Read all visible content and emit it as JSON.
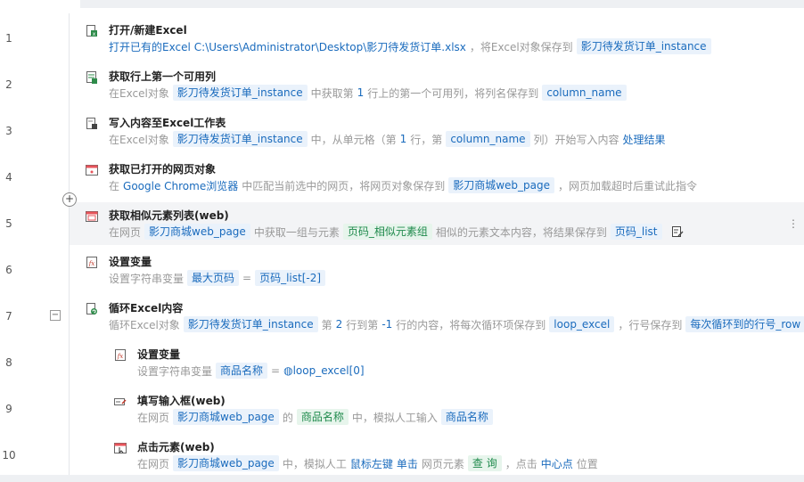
{
  "line_numbers": [
    "1",
    "2",
    "3",
    "4",
    "5",
    "6",
    "7",
    "8",
    "9",
    "10"
  ],
  "steps": [
    {
      "title": "打开/新建Excel",
      "icon": "excel-file-icon",
      "parts": [
        {
          "t": "blue",
          "v": "打开已有的Excel"
        },
        {
          "t": "blue",
          "v": "C:\\Users\\Administrator\\Desktop\\影刀待发货订单.xlsx"
        },
        {
          "t": "text",
          "v": "，将Excel对象保存到"
        },
        {
          "t": "tok",
          "v": "影刀待发货订单_instance"
        }
      ]
    },
    {
      "title": "获取行上第一个可用列",
      "icon": "excel-column-icon",
      "parts": [
        {
          "t": "text",
          "v": "在Excel对象"
        },
        {
          "t": "tok",
          "v": "影刀待发货订单_instance"
        },
        {
          "t": "text",
          "v": "中获取第"
        },
        {
          "t": "kw",
          "v": "1"
        },
        {
          "t": "text",
          "v": "行上的第一个可用列，将列名保存到"
        },
        {
          "t": "tok",
          "v": "column_name"
        }
      ]
    },
    {
      "title": "写入内容至Excel工作表",
      "icon": "excel-write-icon",
      "parts": [
        {
          "t": "text",
          "v": "在Excel对象"
        },
        {
          "t": "tok",
          "v": "影刀待发货订单_instance"
        },
        {
          "t": "text",
          "v": "中，从单元格（第"
        },
        {
          "t": "kw",
          "v": "1"
        },
        {
          "t": "text",
          "v": "行，第"
        },
        {
          "t": "tok",
          "v": "column_name"
        },
        {
          "t": "text",
          "v": "列）开始写入内容"
        },
        {
          "t": "kw",
          "v": "处理结果"
        }
      ]
    },
    {
      "title": "获取已打开的网页对象",
      "icon": "browser-page-icon",
      "parts": [
        {
          "t": "text",
          "v": "在"
        },
        {
          "t": "kw",
          "v": "Google Chrome浏览器"
        },
        {
          "t": "text",
          "v": "中匹配当前选中的网页，将网页对象保存到"
        },
        {
          "t": "tok",
          "v": "影刀商城web_page"
        },
        {
          "t": "text",
          "v": "，网页加载超时后重试此指令"
        }
      ]
    },
    {
      "title": "获取相似元素列表(web)",
      "icon": "similar-elements-icon",
      "parts": [
        {
          "t": "text",
          "v": "在网页"
        },
        {
          "t": "tok",
          "v": "影刀商城web_page"
        },
        {
          "t": "text",
          "v": "中获取一组与元素"
        },
        {
          "t": "tokg",
          "v": "页码_相似元素组"
        },
        {
          "t": "text",
          "v": "相似的元素文本内容，将结果保存到"
        },
        {
          "t": "tok",
          "v": "页码_list"
        }
      ]
    },
    {
      "title": "设置变量",
      "icon": "variable-fx-icon",
      "parts": [
        {
          "t": "text",
          "v": "设置字符串变量"
        },
        {
          "t": "tok",
          "v": "最大页码"
        },
        {
          "t": "text",
          "v": "="
        },
        {
          "t": "tok",
          "v": "页码_list[-2]"
        }
      ]
    },
    {
      "title": "循环Excel内容",
      "icon": "excel-loop-icon",
      "parts": [
        {
          "t": "text",
          "v": "循环Excel对象"
        },
        {
          "t": "tok",
          "v": "影刀待发货订单_instance"
        },
        {
          "t": "text",
          "v": "第"
        },
        {
          "t": "kw",
          "v": "2"
        },
        {
          "t": "text",
          "v": "行到第"
        },
        {
          "t": "kw",
          "v": "-1"
        },
        {
          "t": "text",
          "v": "行的内容，将每次循环项保存到"
        },
        {
          "t": "tok",
          "v": "loop_excel"
        },
        {
          "t": "text",
          "v": "，行号保存到"
        },
        {
          "t": "tok",
          "v": "每次循环到的行号_row"
        }
      ]
    },
    {
      "title": "设置变量",
      "icon": "variable-fx-icon",
      "parts": [
        {
          "t": "text",
          "v": "设置字符串变量"
        },
        {
          "t": "tok",
          "v": "商品名称"
        },
        {
          "t": "text",
          "v": "="
        },
        {
          "t": "var",
          "v": "loop_excel[0]"
        }
      ]
    },
    {
      "title": "填写输入框(web)",
      "icon": "input-fill-icon",
      "parts": [
        {
          "t": "text",
          "v": "在网页"
        },
        {
          "t": "tok",
          "v": "影刀商城web_page"
        },
        {
          "t": "text",
          "v": "的"
        },
        {
          "t": "tokg",
          "v": "商品名称"
        },
        {
          "t": "text",
          "v": "中，模拟人工输入"
        },
        {
          "t": "tok",
          "v": "商品名称"
        }
      ]
    },
    {
      "title": "点击元素(web)",
      "icon": "click-element-icon",
      "parts": [
        {
          "t": "text",
          "v": "在网页"
        },
        {
          "t": "tok",
          "v": "影刀商城web_page"
        },
        {
          "t": "text",
          "v": "中，模拟人工"
        },
        {
          "t": "kw",
          "v": "鼠标左键"
        },
        {
          "t": "kw",
          "v": "单击"
        },
        {
          "t": "text",
          "v": "网页元素"
        },
        {
          "t": "tokg",
          "v": "查 询"
        },
        {
          "t": "text",
          "v": "，点击"
        },
        {
          "t": "kw",
          "v": "中心点"
        },
        {
          "t": "text",
          "v": "位置"
        }
      ]
    }
  ],
  "controls": {
    "plus": "+",
    "collapse": "−",
    "more": "⋮"
  }
}
